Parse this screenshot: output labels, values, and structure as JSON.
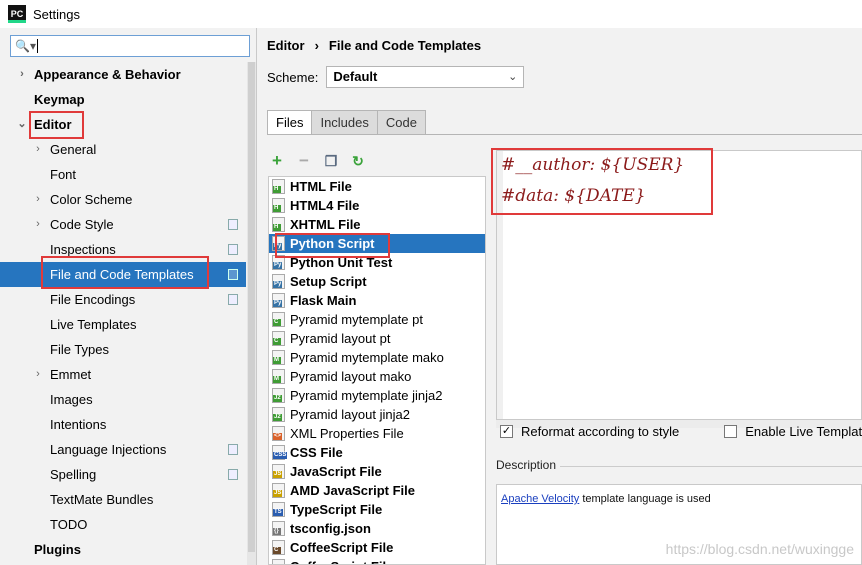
{
  "window": {
    "title": "Settings",
    "app_icon_label": "PC"
  },
  "search": {
    "value": ""
  },
  "sidebar": {
    "items": [
      {
        "label": "Appearance & Behavior",
        "bold": true,
        "chevron": "›",
        "indent": 0
      },
      {
        "label": "Keymap",
        "bold": true,
        "indent": 0
      },
      {
        "label": "Editor",
        "bold": true,
        "chevron": "⌄",
        "indent": 0
      },
      {
        "label": "General",
        "chevron": "›",
        "indent": 1
      },
      {
        "label": "Font",
        "indent": 1
      },
      {
        "label": "Color Scheme",
        "chevron": "›",
        "indent": 1
      },
      {
        "label": "Code Style",
        "chevron": "›",
        "indent": 1,
        "copy": true
      },
      {
        "label": "Inspections",
        "indent": 1,
        "copy": true
      },
      {
        "label": "File and Code Templates",
        "indent": 1,
        "copy": true,
        "selected": true
      },
      {
        "label": "File Encodings",
        "indent": 1,
        "copy": true
      },
      {
        "label": "Live Templates",
        "indent": 1
      },
      {
        "label": "File Types",
        "indent": 1
      },
      {
        "label": "Emmet",
        "chevron": "›",
        "indent": 1
      },
      {
        "label": "Images",
        "indent": 1
      },
      {
        "label": "Intentions",
        "indent": 1
      },
      {
        "label": "Language Injections",
        "indent": 1,
        "copy": true
      },
      {
        "label": "Spelling",
        "indent": 1,
        "copy": true
      },
      {
        "label": "TextMate Bundles",
        "indent": 1
      },
      {
        "label": "TODO",
        "indent": 1
      },
      {
        "label": "Plugins",
        "bold": true,
        "indent": 0
      }
    ]
  },
  "breadcrumb": {
    "parent": "Editor",
    "separator": "›",
    "current": "File and Code Templates"
  },
  "scheme": {
    "label": "Scheme:",
    "value": "Default"
  },
  "tabs": [
    {
      "label": "Files",
      "active": true
    },
    {
      "label": "Includes"
    },
    {
      "label": "Code"
    }
  ],
  "toolbar": {
    "add": "+",
    "remove": "−",
    "copy": "❐",
    "reset": "↻"
  },
  "files": [
    {
      "label": "HTML File",
      "bold": true,
      "icon": "H",
      "color": "#3f9c35"
    },
    {
      "label": "HTML4 File",
      "bold": true,
      "icon": "H",
      "color": "#3f9c35"
    },
    {
      "label": "XHTML File",
      "bold": true,
      "icon": "H",
      "color": "#3f9c35"
    },
    {
      "label": "Python Script",
      "bold": true,
      "icon": "Py",
      "color": "#3572a5",
      "selected": true
    },
    {
      "label": "Python Unit Test",
      "bold": true,
      "icon": "Py",
      "color": "#3572a5"
    },
    {
      "label": "Setup Script",
      "bold": true,
      "icon": "Py",
      "color": "#3572a5"
    },
    {
      "label": "Flask Main",
      "bold": true,
      "icon": "Py",
      "color": "#3572a5"
    },
    {
      "label": "Pyramid mytemplate pt",
      "icon": "C",
      "color": "#3f9c35"
    },
    {
      "label": "Pyramid layout pt",
      "icon": "C",
      "color": "#3f9c35"
    },
    {
      "label": "Pyramid mytemplate mako",
      "icon": "M",
      "color": "#3f9c35"
    },
    {
      "label": "Pyramid layout mako",
      "icon": "M",
      "color": "#3f9c35"
    },
    {
      "label": "Pyramid mytemplate jinja2",
      "icon": "J2",
      "color": "#3f9c35"
    },
    {
      "label": "Pyramid layout jinja2",
      "icon": "J2",
      "color": "#3f9c35"
    },
    {
      "label": "XML Properties File",
      "icon": "<>",
      "color": "#d9622b"
    },
    {
      "label": "CSS File",
      "bold": true,
      "icon": "CSS",
      "color": "#2a5db0"
    },
    {
      "label": "JavaScript File",
      "bold": true,
      "icon": "JS",
      "color": "#c9a100"
    },
    {
      "label": "AMD JavaScript File",
      "bold": true,
      "icon": "JS",
      "color": "#c9a100"
    },
    {
      "label": "TypeScript File",
      "bold": true,
      "icon": "TS",
      "color": "#2a5db0"
    },
    {
      "label": "tsconfig.json",
      "bold": true,
      "icon": "{}",
      "color": "#777777"
    },
    {
      "label": "CoffeeScript File",
      "bold": true,
      "icon": "C",
      "color": "#6b4a2b"
    },
    {
      "label": "CoffeeScript File",
      "bold": true,
      "icon": "C",
      "color": "#6b4a2b"
    }
  ],
  "editor": {
    "line1": {
      "prefix": "#__author: ",
      "variable": "${USER}"
    },
    "line2": {
      "prefix": "#data: ",
      "variable": "${DATE}"
    }
  },
  "options": {
    "reformat": {
      "label": "Reformat according to style",
      "checked": true,
      "mark": "✓"
    },
    "live": {
      "label": "Enable Live Templates",
      "checked": false
    }
  },
  "description": {
    "label": "Description",
    "link": "Apache Velocity",
    "text": " template language is used"
  },
  "watermark": "https://blog.csdn.net/wuxingge",
  "colors": {
    "selection": "#2675bf",
    "highlight": "#e03a3a",
    "code": "#8b1a1a"
  }
}
